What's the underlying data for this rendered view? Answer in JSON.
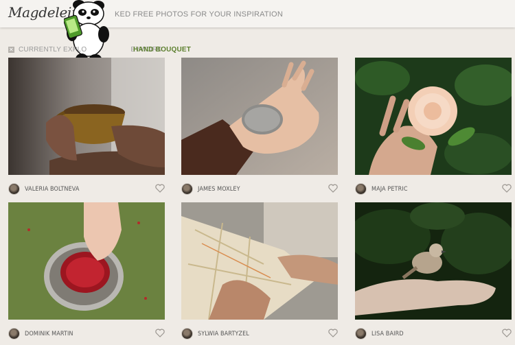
{
  "header": {
    "logo": "Magdeleine",
    "tagline": "KED FREE PHOTOS FOR YOUR INSPIRATION"
  },
  "explore": {
    "prefix": "CURRENTLY EXPLO",
    "middle": "EYWORD",
    "keyword": "HAND BOUQUET",
    "close_icon": "✕"
  },
  "photos": [
    {
      "author": "VALERIA BOLTNEVA",
      "subject": "hands-holding-cup",
      "icon": "heart-icon"
    },
    {
      "author": "JAMES MOXLEY",
      "subject": "hand-holding-stone",
      "icon": "heart-icon"
    },
    {
      "author": "MAJA PETRIC",
      "subject": "hand-holding-rose",
      "icon": "heart-icon"
    },
    {
      "author": "DOMINIK MARTIN",
      "subject": "hand-berries-bowl",
      "icon": "heart-icon"
    },
    {
      "author": "SYLWIA BARTYZEL",
      "subject": "hands-holding-map",
      "icon": "heart-icon"
    },
    {
      "author": "LISA BAIRD",
      "subject": "bird-on-hand",
      "icon": "heart-icon"
    }
  ],
  "colors": {
    "background": "#efebe6",
    "header": "#f5f3f0",
    "keyword": "#5b7f2d"
  }
}
